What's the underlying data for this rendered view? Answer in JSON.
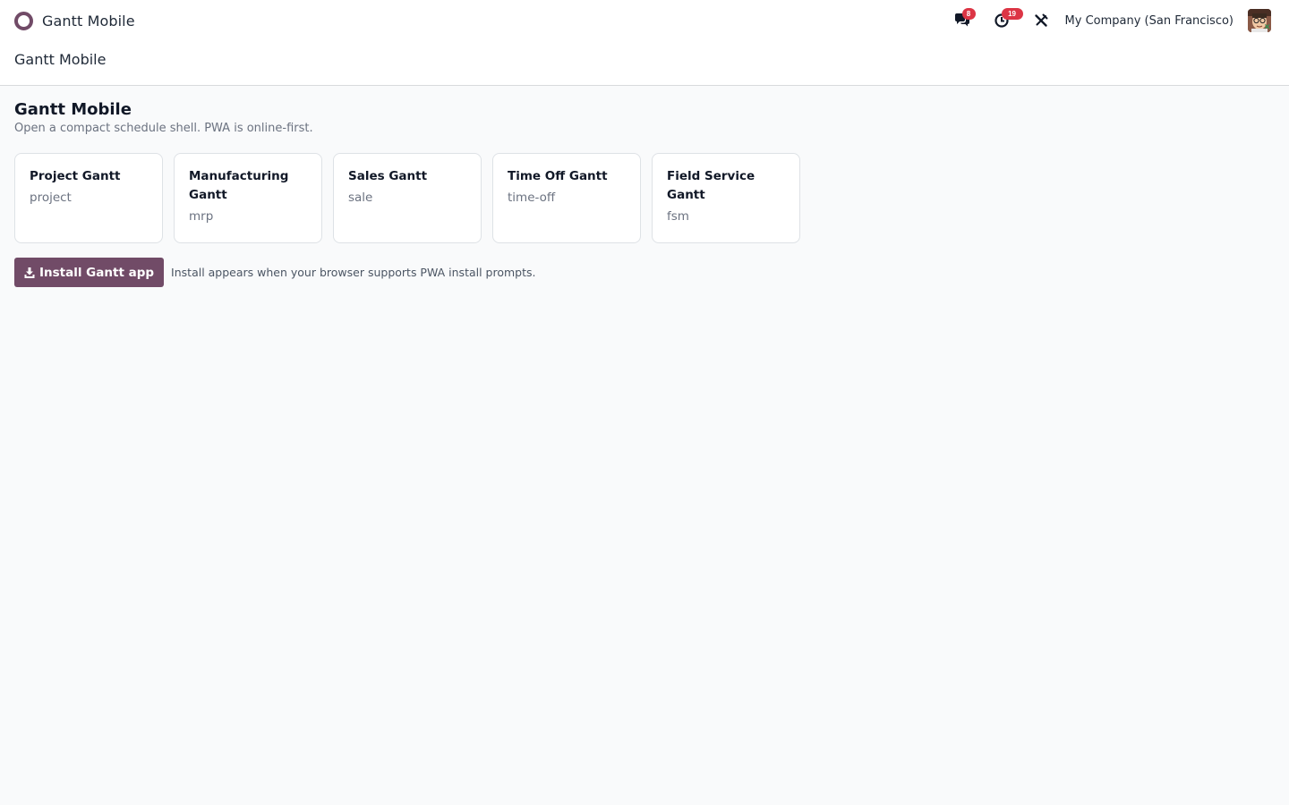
{
  "navbar": {
    "app_name": "Gantt Mobile",
    "messages_count": "8",
    "activities_count": "19",
    "company": "My Company (San Francisco)"
  },
  "breadcrumb": {
    "current": "Gantt Mobile"
  },
  "main": {
    "title": "Gantt Mobile",
    "subtitle": "Open a compact schedule shell. PWA is online-first.",
    "cards": [
      {
        "title": "Project Gantt",
        "code": "project"
      },
      {
        "title": "Manufacturing Gantt",
        "code": "mrp"
      },
      {
        "title": "Sales Gantt",
        "code": "sale"
      },
      {
        "title": "Time Off Gantt",
        "code": "time-off"
      },
      {
        "title": "Field Service Gantt",
        "code": "fsm"
      }
    ],
    "install_label": "Install Gantt app",
    "install_hint": "Install appears when your browser supports PWA install prompts."
  },
  "colors": {
    "brand": "#714B67",
    "badge": "#dc3545",
    "background": "#f9fafb"
  },
  "icons": {
    "logo": "app-logo-ring",
    "messages": "chat-bubbles-icon",
    "activities": "clock-icon",
    "debug": "tools-icon",
    "install": "download-icon"
  }
}
